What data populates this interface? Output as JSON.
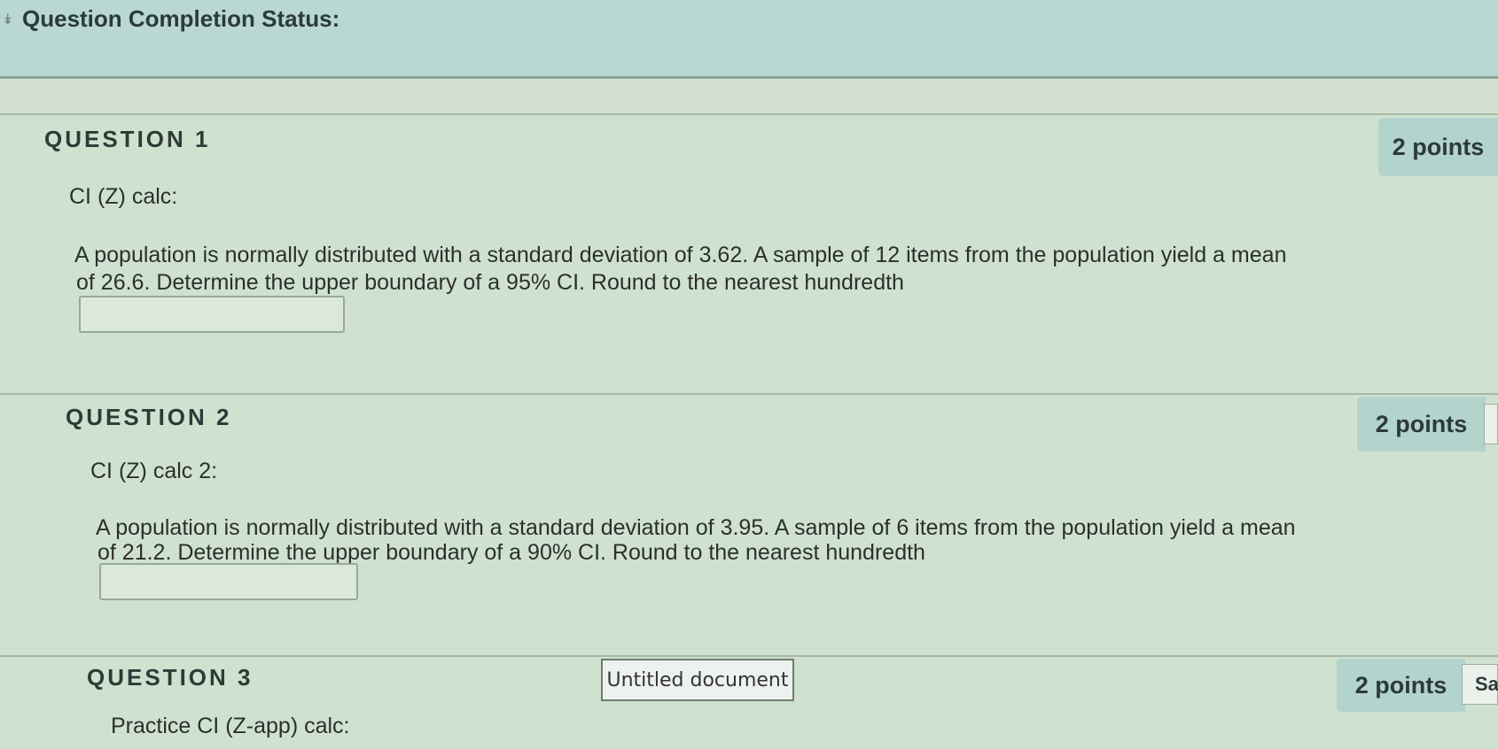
{
  "status": {
    "title": "Question Completion Status:",
    "arrow_icon": "double-chevron-down-icon"
  },
  "questions": [
    {
      "heading": "QUESTION 1",
      "points": "2 points",
      "subtitle": "CI (Z) calc:",
      "text_line1": "A population is normally distributed with a standard deviation of 3.62. A sample of 12 items from the population yield a mean",
      "text_line2": "of 26.6. Determine the upper boundary of a 95% CI. Round to the nearest hundredth",
      "answer_value": ""
    },
    {
      "heading": "QUESTION 2",
      "points": "2 points",
      "subtitle": "CI (Z) calc 2:",
      "text_line1": "A population is normally distributed with a standard deviation of 3.95. A sample of 6 items from the population yield a mean",
      "text_line2": "of 21.2. Determine the upper boundary of a 90% CI. Round to the nearest hundredth",
      "answer_value": ""
    },
    {
      "heading": "QUESTION 3",
      "points": "2 points",
      "subtitle": "Practice CI (Z-app) calc:",
      "save_label": "Sa"
    }
  ],
  "tooltip": {
    "label": "Untitled document"
  },
  "colors": {
    "background": "#cfe0cf",
    "status_bar": "#b9d8d3",
    "points_tab": "#b3d3cd"
  }
}
